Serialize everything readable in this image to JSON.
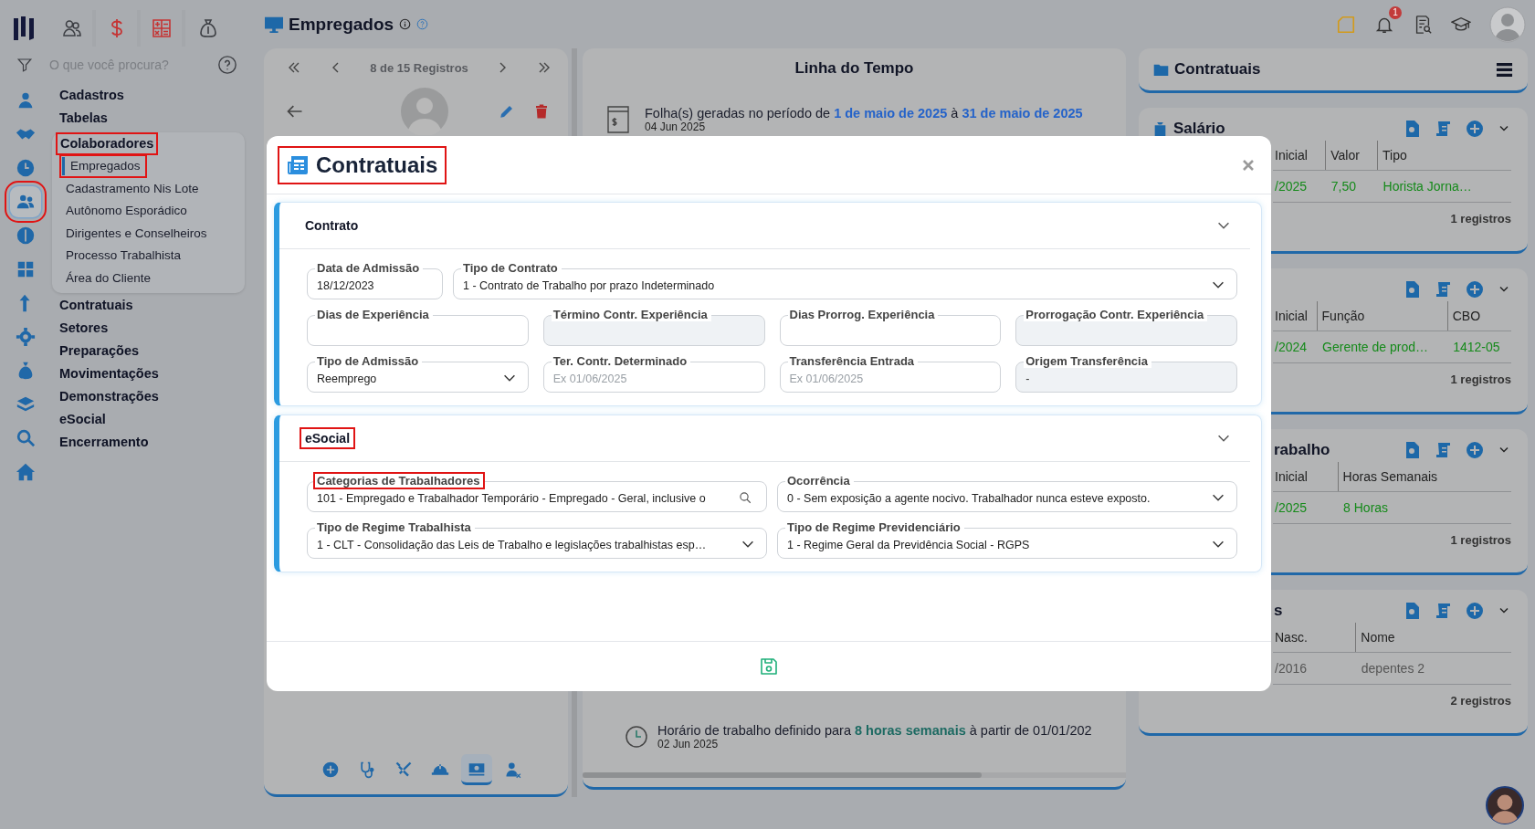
{
  "sidebar": {
    "search": {
      "placeholder": "O que você procura?"
    },
    "rail": [
      {
        "selected": false,
        "highlighted": false
      },
      {
        "selected": false,
        "highlighted": false
      },
      {
        "selected": false,
        "highlighted": false
      },
      {
        "selected": true,
        "highlighted": true
      },
      {
        "selected": false,
        "highlighted": false
      },
      {
        "selected": false,
        "highlighted": false
      },
      {
        "selected": false,
        "highlighted": false
      },
      {
        "selected": false,
        "highlighted": false
      },
      {
        "selected": false,
        "highlighted": false
      },
      {
        "selected": false,
        "highlighted": false
      },
      {
        "selected": false,
        "highlighted": false
      },
      {
        "selected": false,
        "highlighted": false
      }
    ],
    "menu": [
      {
        "label": "Cadastros",
        "highlighted": false
      },
      {
        "label": "Tabelas",
        "highlighted": false
      },
      {
        "label": "Colaboradores",
        "highlighted": true,
        "expanded": true,
        "children": [
          {
            "label": "Empregados",
            "selected": true,
            "highlighted": true
          },
          {
            "label": "Cadastramento Nis Lote",
            "selected": false,
            "highlighted": false
          },
          {
            "label": "Autônomo Esporádico",
            "selected": false,
            "highlighted": false
          },
          {
            "label": "Dirigentes e Conselheiros",
            "selected": false,
            "highlighted": false
          },
          {
            "label": "Processo Trabalhista",
            "selected": false,
            "highlighted": false
          },
          {
            "label": "Área do Cliente",
            "selected": false,
            "highlighted": false
          }
        ]
      },
      {
        "label": "Contratuais",
        "highlighted": false
      },
      {
        "label": "Setores",
        "highlighted": false
      },
      {
        "label": "Preparações",
        "highlighted": false
      },
      {
        "label": "Movimentações",
        "highlighted": false
      },
      {
        "label": "Demonstrações",
        "highlighted": false
      },
      {
        "label": "eSocial",
        "highlighted": false
      },
      {
        "label": "Encerramento",
        "highlighted": false
      }
    ]
  },
  "header": {
    "title": "Empregados",
    "notifications": "1"
  },
  "record_nav": {
    "label": "8 de 15 Registros"
  },
  "employee_tabs": [
    {
      "selected": false
    },
    {
      "selected": false
    },
    {
      "selected": false
    },
    {
      "selected": false
    },
    {
      "selected": true
    },
    {
      "selected": false
    }
  ],
  "timeline": {
    "title": "Linha do Tempo",
    "events": [
      {
        "kind": "payroll",
        "text": "Folha(s) geradas no período de **1 de maio de 2025** à **31 de maio de 2025**",
        "date": "04 Jun 2025"
      },
      {
        "kind": "schedule",
        "text": "Horário de trabalho definido para **8 horas semanais** à partir de 01/01/202",
        "date": "02 Jun 2025"
      }
    ]
  },
  "panel": {
    "title": "Contratuais",
    "cards": [
      {
        "title": "Salário",
        "columns": [
          "Inicial",
          "Valor",
          "Tipo"
        ],
        "rows": [
          {
            "active": true,
            "cells": [
              "/2025",
              "7,50",
              "Horista Jorna…"
            ]
          }
        ],
        "footer": "1 registros"
      },
      {
        "columns": [
          "Inicial",
          "Função",
          "CBO"
        ],
        "rows": [
          {
            "active": true,
            "cells": [
              "/2024",
              "Gerente de prod…",
              "1412-05"
            ]
          }
        ],
        "footer": "1 registros"
      },
      {
        "title": "rabalho",
        "columns": [
          "Inicial",
          "Horas Semanais"
        ],
        "rows": [
          {
            "active": true,
            "cells": [
              "/2025",
              "8 Horas"
            ]
          }
        ],
        "footer": "1 registros"
      },
      {
        "title": "s",
        "columns": [
          "Nasc.",
          "Nome"
        ],
        "rows": [
          {
            "active": false,
            "cells": [
              "/2016",
              "depentes 2"
            ]
          }
        ],
        "footer": "2 registros"
      }
    ]
  },
  "modal": {
    "title": "Contratuais",
    "highlighted": true,
    "sections": [
      {
        "title": "Contrato",
        "highlighted": false,
        "expanded": true,
        "rows": [
          [
            {
              "label": "Data de Admissão",
              "value": "18/12/2023",
              "kind": "text",
              "disabled": false
            },
            {
              "label": "Tipo de Contrato",
              "value": "1 - Contrato de Trabalho por prazo Indeterminado",
              "kind": "select",
              "disabled": false
            }
          ],
          [
            {
              "label": "Dias de Experiência",
              "kind": "text",
              "disabled": false
            },
            {
              "label": "Término Contr. Experiência",
              "kind": "text",
              "disabled": true
            },
            {
              "label": "Dias Prorrog. Experiência",
              "kind": "text",
              "disabled": false
            },
            {
              "label": "Prorrogação Contr. Experiência",
              "kind": "text",
              "disabled": true
            }
          ],
          [
            {
              "label": "Tipo de Admissão",
              "value": "Reemprego",
              "kind": "select",
              "disabled": false
            },
            {
              "label": "Ter. Contr. Determinado",
              "placeholder": "Ex 01/06/2025",
              "kind": "text",
              "disabled": false
            },
            {
              "label": "Transferência Entrada",
              "placeholder": "Ex 01/06/2025",
              "kind": "text",
              "disabled": false
            },
            {
              "label": "Origem Transferência",
              "value": "-",
              "kind": "text",
              "disabled": true
            }
          ]
        ]
      },
      {
        "title": "eSocial",
        "highlighted": true,
        "expanded": true,
        "rows": [
          [
            {
              "label": "Categorias de Trabalhadores",
              "value": "101 - Empregado e Trabalhador Temporário - Empregado - Geral, inclusive o",
              "kind": "search",
              "disabled": false,
              "highlighted": true
            },
            {
              "label": "Ocorrência",
              "value": "0 - Sem exposição a agente nocivo. Trabalhador nunca esteve exposto.",
              "kind": "select",
              "disabled": false,
              "highlighted": false
            }
          ],
          [
            {
              "label": "Tipo de Regime Trabalhista",
              "value": "1 - CLT - Consolidação das Leis de Trabalho e legislações trabalhistas esp…",
              "kind": "select",
              "disabled": false,
              "highlighted": false
            },
            {
              "label": "Tipo de Regime Previdenciário",
              "value": "1 - Regime Geral da Previdência Social - RGPS",
              "kind": "select",
              "disabled": false,
              "highlighted": false
            }
          ]
        ]
      }
    ]
  }
}
